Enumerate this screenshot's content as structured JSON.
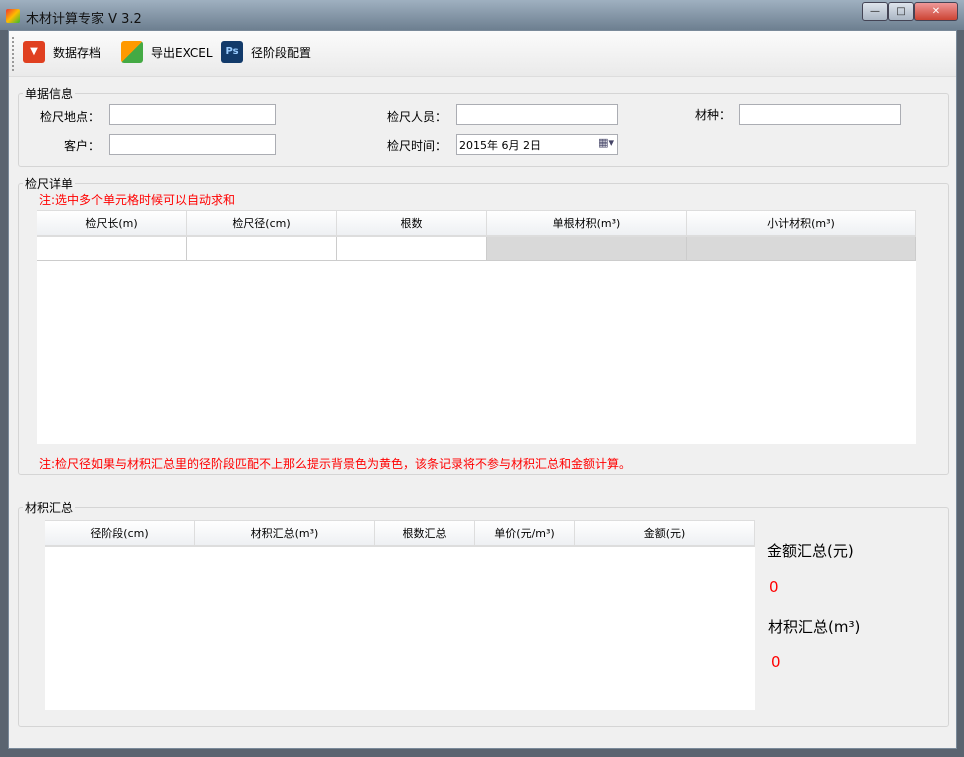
{
  "window": {
    "title": "木材计算专家 V 3.2",
    "min": "—",
    "max": "□",
    "close": "✕"
  },
  "toolbar": {
    "save": "数据存档",
    "export": "导出EXCEL",
    "config": "径阶段配置"
  },
  "doc": {
    "legend": "单据信息",
    "location_label": "检尺地点：",
    "inspector_label": "检尺人员：",
    "species_label": "材种：",
    "customer_label": "客户：",
    "time_label": "检尺时间：",
    "date_value": "2015年  6月  2日",
    "location": "",
    "inspector": "",
    "species": "",
    "customer": ""
  },
  "detail": {
    "legend": "检尺详单",
    "note_top": "注:选中多个单元格时候可以自动求和",
    "columns": [
      "检尺长(m)",
      "检尺径(cm)",
      "根数",
      "单根材积(m³)",
      "小计材积(m³)"
    ],
    "note_bottom": "注:检尺径如果与材积汇总里的径阶段匹配不上那么提示背景色为黄色，该条记录将不参与材积汇总和金额计算。"
  },
  "summary": {
    "legend": "材积汇总",
    "columns": [
      "径阶段(cm)",
      "材积汇总(m³)",
      "根数汇总",
      "单价(元/m³)",
      "金额(元)"
    ],
    "amount_label": "金额汇总(元)",
    "amount_value": "0",
    "volume_label": "材积汇总(m³)",
    "volume_value": "0"
  }
}
